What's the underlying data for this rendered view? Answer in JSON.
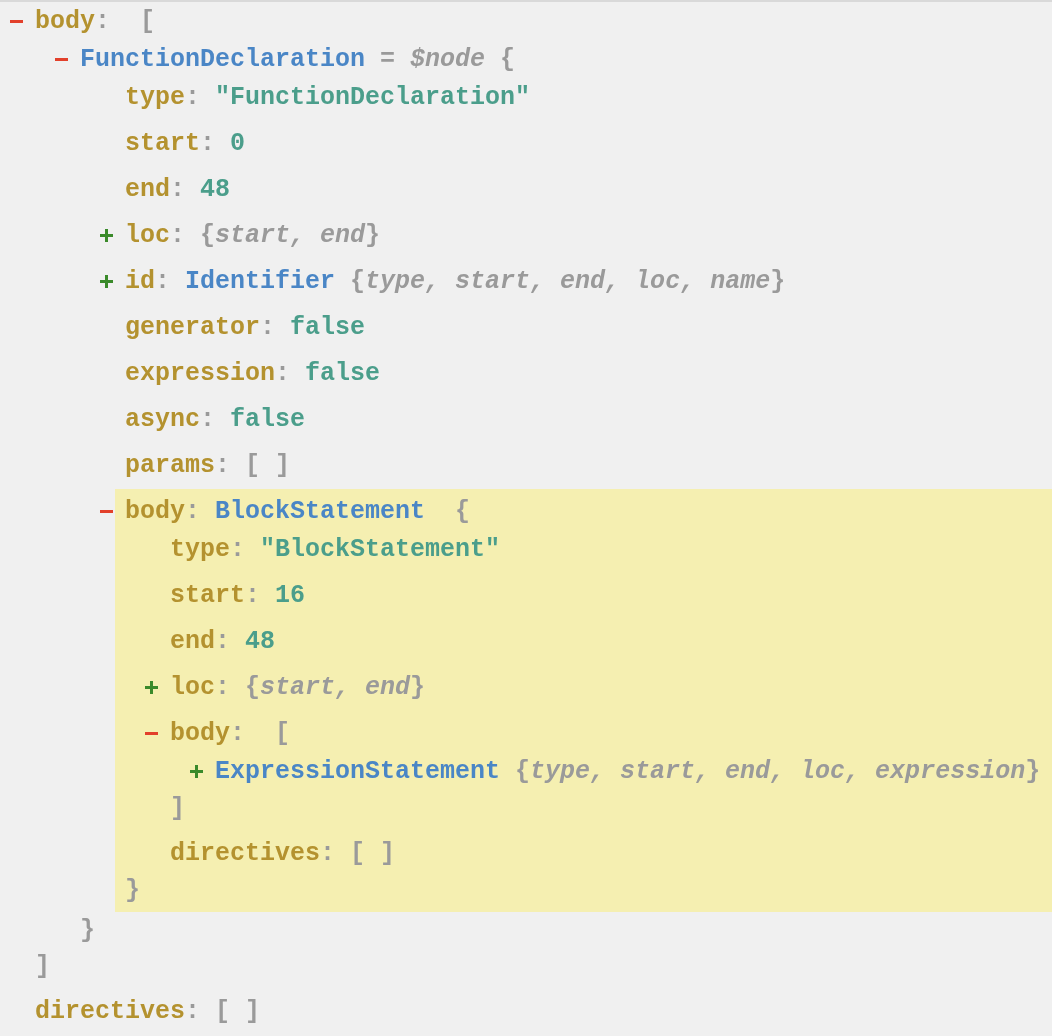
{
  "tree": [
    {
      "kind": "array",
      "key": "body",
      "colon": ":",
      "expanded": true,
      "highlighted": false,
      "open": "[",
      "close": "]",
      "children": [
        {
          "kind": "node",
          "type_name": "FunctionDeclaration",
          "alias": "= *$node*",
          "expanded": true,
          "highlighted": false,
          "open": "{",
          "close": "}",
          "children": [
            {
              "kind": "value",
              "key": "type",
              "colon": ":",
              "value": "\"FunctionDeclaration\"",
              "highlighted": false
            },
            {
              "kind": "value",
              "key": "start",
              "colon": ":",
              "value": "0",
              "highlighted": false
            },
            {
              "kind": "value",
              "key": "end",
              "colon": ":",
              "value": "48",
              "highlighted": false
            },
            {
              "kind": "object",
              "key": "loc",
              "colon": ":",
              "expanded": false,
              "summary": "{*start, end*}",
              "highlighted": false
            },
            {
              "kind": "node",
              "key": "id",
              "colon": ":",
              "type_name": "Identifier",
              "expanded": false,
              "summary": "{*type, start, end, loc, name*}",
              "highlighted": false
            },
            {
              "kind": "value",
              "key": "generator",
              "colon": ":",
              "value": "false",
              "highlighted": false
            },
            {
              "kind": "value",
              "key": "expression",
              "colon": ":",
              "value": "false",
              "highlighted": false
            },
            {
              "kind": "value",
              "key": "async",
              "colon": ":",
              "value": "false",
              "highlighted": false
            },
            {
              "kind": "empty",
              "key": "params",
              "colon": ":",
              "value": "[ ]",
              "highlighted": false
            },
            {
              "kind": "node",
              "key": "body",
              "colon": ":",
              "type_name": "BlockStatement",
              "expanded": true,
              "highlighted": true,
              "open": "{",
              "close": "}",
              "children": [
                {
                  "kind": "value",
                  "key": "type",
                  "colon": ":",
                  "value": "\"BlockStatement\"",
                  "highlighted": false
                },
                {
                  "kind": "value",
                  "key": "start",
                  "colon": ":",
                  "value": "16",
                  "highlighted": false
                },
                {
                  "kind": "value",
                  "key": "end",
                  "colon": ":",
                  "value": "48",
                  "highlighted": false
                },
                {
                  "kind": "object",
                  "key": "loc",
                  "colon": ":",
                  "expanded": false,
                  "summary": "{*start, end*}",
                  "highlighted": false
                },
                {
                  "kind": "array",
                  "key": "body",
                  "colon": ":",
                  "expanded": true,
                  "highlighted": false,
                  "open": "[",
                  "close": "]",
                  "children": [
                    {
                      "kind": "node",
                      "type_name": "ExpressionStatement",
                      "expanded": false,
                      "summary": "{*type, start, end, loc, expression*}",
                      "highlighted": false
                    }
                  ]
                },
                {
                  "kind": "empty",
                  "key": "directives",
                  "colon": ":",
                  "value": "[ ]",
                  "highlighted": false
                }
              ]
            }
          ]
        }
      ]
    },
    {
      "kind": "empty",
      "key": "directives",
      "colon": ":",
      "value": "[ ]",
      "highlighted": false
    }
  ]
}
